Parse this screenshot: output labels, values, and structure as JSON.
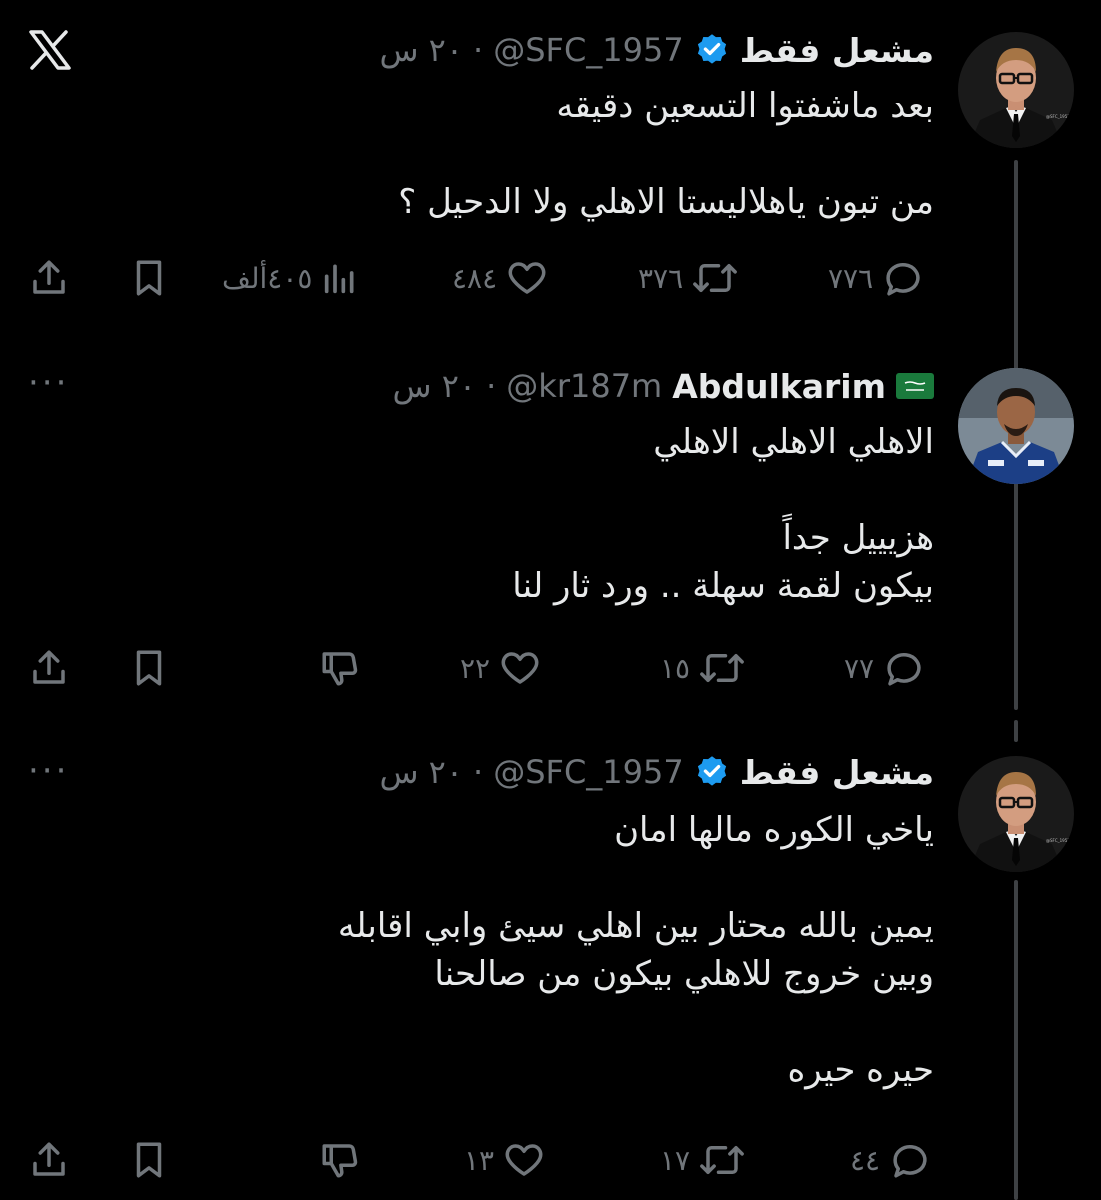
{
  "colors": {
    "background": "#000000",
    "text": "#e7e9ea",
    "muted": "#71767b",
    "verified": "#1d9bf0",
    "thread_line": "#3e4144"
  },
  "icons": {
    "logo": "x-logo-icon",
    "reply": "reply-icon",
    "retweet": "retweet-icon",
    "like": "heart-icon",
    "views": "views-icon",
    "dislike": "thumbs-down-icon",
    "bookmark": "bookmark-icon",
    "share": "share-icon"
  },
  "tweets": [
    {
      "name": "مشعل فقط",
      "handle": "@SFC_1957",
      "dot": "·",
      "time": "٢٠ س",
      "verified": true,
      "lines": [
        "بعد ماشفتوا التسعين دقيقه",
        "",
        "من تبون ياهلاليستا الاهلي ولا الدحيل ؟"
      ],
      "replies": "٧٧٦",
      "retweets": "٣٧٦",
      "likes": "٤٨٤",
      "views": "٤٠٥ألف"
    },
    {
      "name": "Abdulkarim",
      "handle": "@kr187m",
      "dot": "·",
      "time": "٢٠ س",
      "flag": "saudi-flag-icon",
      "more": "···",
      "lines": [
        "الاهلي الاهلي الاهلي",
        "",
        "هزيييل جداً",
        "بيكون لقمة سهلة .. ورد ثار لنا"
      ],
      "replies": "٧٧",
      "retweets": "١٥",
      "likes": "٢٢"
    },
    {
      "name": "مشعل فقط",
      "handle": "@SFC_1957",
      "dot": "·",
      "time": "٢٠ س",
      "verified": true,
      "more": "···",
      "lines": [
        "ياخي الكوره مالها امان",
        "",
        "يمين بالله محتار بين اهلي سيئ وابي اقابله",
        "وبين خروج للاهلي بيكون من صالحنا",
        "",
        "حيره حيره"
      ],
      "replies": "٤٤",
      "retweets": "١٧",
      "likes": "١٣"
    }
  ]
}
